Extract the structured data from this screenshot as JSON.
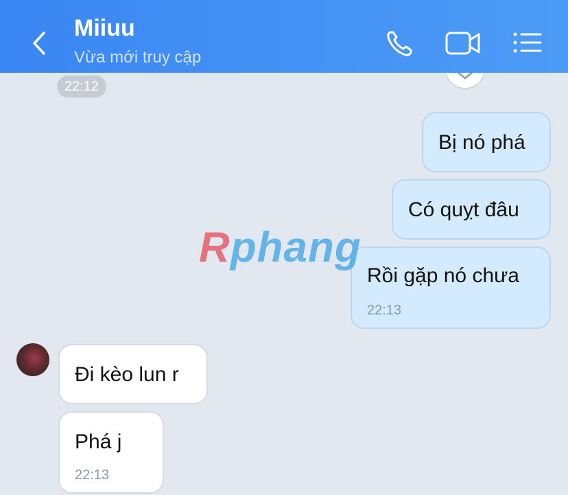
{
  "header": {
    "title": "Miiuu",
    "status": "Vừa mới truy cập"
  },
  "divider_time": "22:12",
  "messages": [
    {
      "side": "out",
      "text": "Bị nó phá"
    },
    {
      "side": "out",
      "text": "Có quỵt đâu"
    },
    {
      "side": "out",
      "text": "Rồi gặp nó chưa",
      "time": "22:13"
    },
    {
      "side": "in",
      "text": "Đi kèo lun r"
    },
    {
      "side": "in",
      "text": "Phá j",
      "time": "22:13"
    }
  ],
  "watermark": {
    "first": "R",
    "rest": "phang"
  },
  "colors": {
    "header_start": "#3a86f3",
    "header_end": "#4c9cf6",
    "background": "#e2e8f0",
    "outgoing_bubble": "#d4ebfd",
    "incoming_bubble": "#ffffff"
  },
  "icons": [
    "back-arrow-icon",
    "phone-icon",
    "video-camera-icon",
    "menu-list-icon",
    "chevron-down-icon"
  ]
}
